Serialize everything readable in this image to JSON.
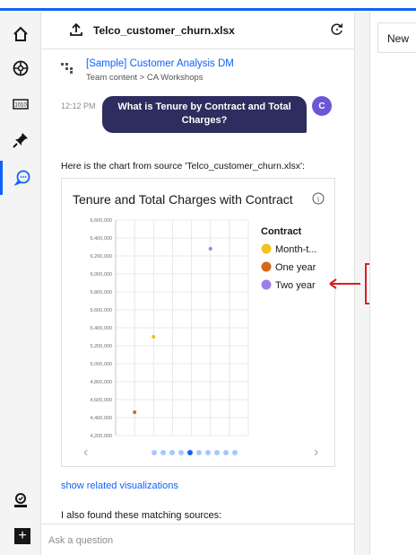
{
  "header": {
    "file_title": "Telco_customer_churn.xlsx"
  },
  "rail": {
    "items": [
      "home-icon",
      "explore-icon",
      "data-icon",
      "pin-icon",
      "chat-icon",
      "user-icon"
    ]
  },
  "source": {
    "link": "[Sample] Customer Analysis DM",
    "path": "Team content > CA Workshops"
  },
  "message": {
    "time": "12:12 PM",
    "text": "What is Tenure by Contract and Total Charges?",
    "avatar": "C"
  },
  "reply": {
    "text": "Here is the chart from source 'Telco_customer_churn.xlsx':"
  },
  "chart_data": {
    "type": "scatter",
    "title": "Tenure and Total Charges with Contract",
    "legend_title": "Contract",
    "legend_placement": "right",
    "grid": true,
    "ylim": [
      4200000,
      6600000
    ],
    "y_ticks": [
      "6,600,000",
      "6,400,000",
      "6,200,000",
      "6,000,000",
      "5,800,000",
      "5,600,000",
      "5,400,000",
      "5,200,000",
      "5,000,000",
      "4,800,000",
      "4,600,000",
      "4,400,000",
      "4,200,000"
    ],
    "series": [
      {
        "name": "Month-t...",
        "color": "#f1c21b",
        "points": [
          {
            "x": 2,
            "y": 5300000
          }
        ]
      },
      {
        "name": "One year",
        "color": "#d2691e",
        "points": [
          {
            "x": 1,
            "y": 4460000
          }
        ]
      },
      {
        "name": "Two year",
        "color": "#9b7ee8",
        "points": [
          {
            "x": 5,
            "y": 6280000
          }
        ]
      }
    ]
  },
  "carousel": {
    "prev": "‹",
    "next": "›",
    "count": 10,
    "active_index": 4
  },
  "links": {
    "related": "show related visualizations"
  },
  "also": {
    "text": "I also found these matching sources:"
  },
  "input": {
    "placeholder": "Ask a question"
  },
  "right": {
    "tab_label": "New"
  },
  "colors": {
    "accent": "#0f62fe",
    "bubble": "#2d2d5f",
    "avatar": "#6b57d6",
    "highlight": "#da1e28"
  }
}
